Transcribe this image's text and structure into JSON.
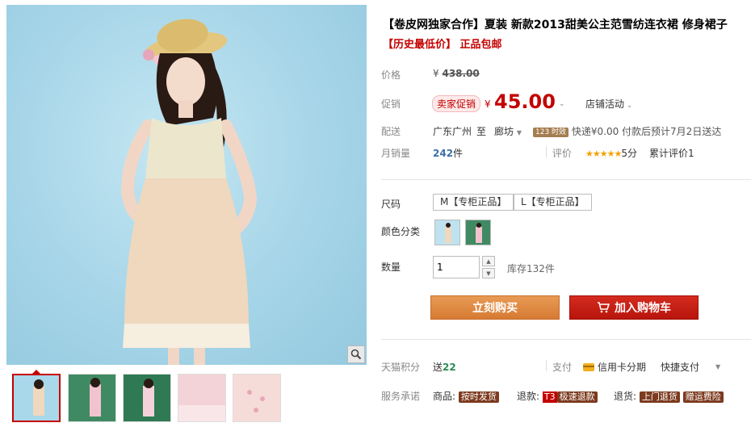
{
  "product": {
    "title": "【卷皮网独家合作】夏装 新款2013甜美公主范雪纺连衣裙 修身裙子",
    "subtitle": "【历史最低价】 正品包邮"
  },
  "price_section": {
    "price_label": "价格",
    "original_price": "438.00",
    "promo_label": "促销",
    "promo_tag": "卖家促销",
    "promo_price": "45.00",
    "currency": "¥",
    "store_events": "店铺活动"
  },
  "shipping": {
    "label": "配送",
    "from": "广东广州",
    "to_word": "至",
    "destination": "廊坊",
    "badge": "123 时效",
    "info": "快递¥0.00 付款后预计7月2日送达"
  },
  "sales": {
    "label": "月销量",
    "count": "242",
    "unit": "件",
    "review_label": "评价",
    "stars": "★★★★★",
    "score": "5分",
    "review_count": "累计评价1"
  },
  "options": {
    "size_label": "尺码",
    "sizes": [
      "M【专柜正品】",
      "L【专柜正品】"
    ],
    "color_label": "颜色分类",
    "quantity_label": "数量",
    "quantity_value": "1",
    "stock": "库存132件"
  },
  "actions": {
    "buy_now": "立刻购买",
    "add_to_cart": "加入购物车"
  },
  "extras": {
    "points_label": "天猫积分",
    "points_text": "送",
    "points_value": "22",
    "pay_label": "支付",
    "credit_card": "信用卡分期",
    "quick_pay": "快捷支付",
    "service_label": "服务承诺",
    "goods_label": "商品:",
    "goods_tag": "按时发货",
    "refund_label": "退款:",
    "refund_t3": "T3",
    "refund_tag": "极速退款",
    "return_label": "退货:",
    "return_tag": "上门退货",
    "return_tag2": "赠运费险"
  },
  "colors": {
    "accent_red": "#c40000",
    "buy_orange": "#e08b44",
    "cart_red": "#c8180e",
    "photo_bg": "#a9d8ea"
  }
}
